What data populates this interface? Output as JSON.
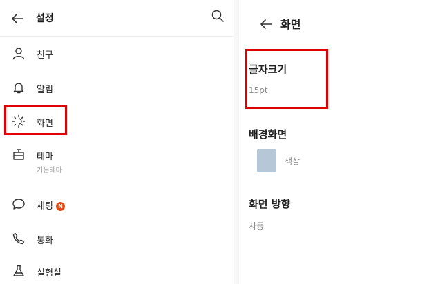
{
  "left_panel": {
    "title": "설정",
    "items": [
      {
        "label": "친구",
        "icon": "person-icon"
      },
      {
        "label": "알림",
        "icon": "bell-icon"
      },
      {
        "label": "화면",
        "icon": "brightness-icon"
      },
      {
        "label": "테마",
        "sub": "기본테마",
        "icon": "theme-icon"
      },
      {
        "label": "채팅",
        "badge": "N",
        "icon": "chat-bubble-icon"
      },
      {
        "label": "통화",
        "icon": "phone-icon"
      },
      {
        "label": "실험실",
        "icon": "flask-icon"
      }
    ]
  },
  "right_panel": {
    "title": "화면",
    "font_size": {
      "label": "글자크기",
      "value": "15pt"
    },
    "background": {
      "label": "배경화면",
      "option_label": "색상",
      "swatch_color": "#b6c7d8"
    },
    "orientation": {
      "label": "화면 방향",
      "value": "자동"
    }
  },
  "colors": {
    "highlight": "#e00000",
    "badge": "#e64a19"
  }
}
